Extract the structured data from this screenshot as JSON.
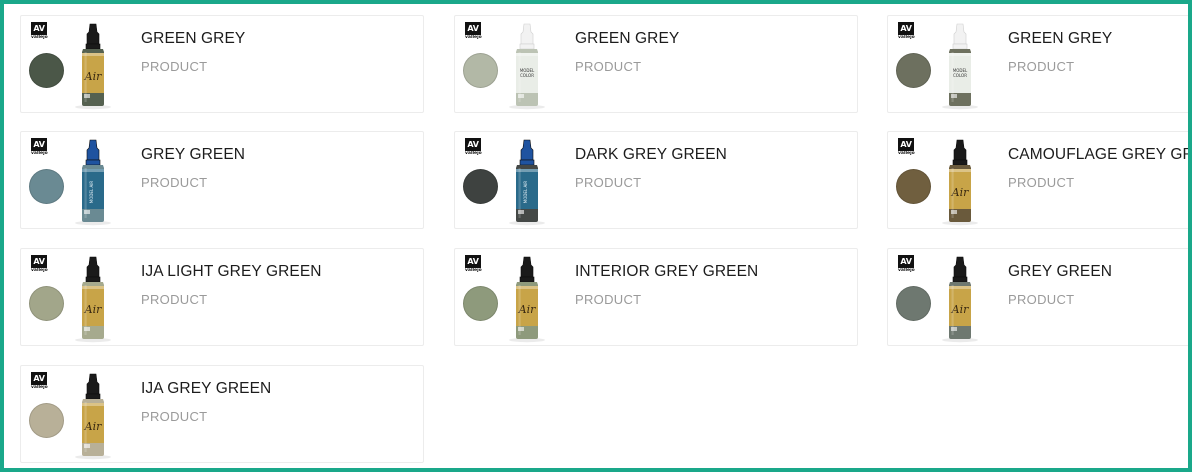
{
  "brand": {
    "logo_text": "AV",
    "logo_sub": "vallejo"
  },
  "products": [
    {
      "name": "GREEN GREY",
      "type": "PRODUCT",
      "swatch": "#4b5748",
      "cap": "#1a1a1a",
      "label": "#c8a448",
      "body": "#556150",
      "line": "air"
    },
    {
      "name": "GREEN GREY",
      "type": "PRODUCT",
      "swatch": "#b2b8a6",
      "cap": "#f2f2f2",
      "label": "#e9ede7",
      "body": "#bcc3b4",
      "line": "color"
    },
    {
      "name": "GREEN GREY",
      "type": "PRODUCT",
      "swatch": "#6d705f",
      "cap": "#f2f2f2",
      "label": "#e9ede7",
      "body": "#6e715f",
      "line": "color"
    },
    {
      "name": "GREY GREEN",
      "type": "PRODUCT",
      "swatch": "#6a8a93",
      "cap": "#1f53a0",
      "label": "#2a6a8a",
      "body": "#6a8a93",
      "line": "blue"
    },
    {
      "name": "DARK GREY GREEN",
      "type": "PRODUCT",
      "swatch": "#3e4240",
      "cap": "#1f53a0",
      "label": "#2a6a8a",
      "body": "#444846",
      "line": "blue"
    },
    {
      "name": "CAMOUFLAGE GREY GREEN",
      "type": "PRODUCT",
      "swatch": "#705f3f",
      "cap": "#1a1a1a",
      "label": "#c8a448",
      "body": "#6a5a3c",
      "line": "air"
    },
    {
      "name": "IJA LIGHT GREY GREEN",
      "type": "PRODUCT",
      "swatch": "#a2a68a",
      "cap": "#1a1a1a",
      "label": "#c8a448",
      "body": "#a6aa8e",
      "line": "air"
    },
    {
      "name": "INTERIOR GREY GREEN",
      "type": "PRODUCT",
      "swatch": "#8e9a7c",
      "cap": "#1a1a1a",
      "label": "#c8a448",
      "body": "#8e9a7c",
      "line": "air"
    },
    {
      "name": "GREY GREEN",
      "type": "PRODUCT",
      "swatch": "#6e7870",
      "cap": "#1a1a1a",
      "label": "#c8a448",
      "body": "#6e7870",
      "line": "air"
    },
    {
      "name": "IJA GREY GREEN",
      "type": "PRODUCT",
      "swatch": "#b8b098",
      "cap": "#1a1a1a",
      "label": "#c8a448",
      "body": "#b8b098",
      "line": "air"
    }
  ]
}
